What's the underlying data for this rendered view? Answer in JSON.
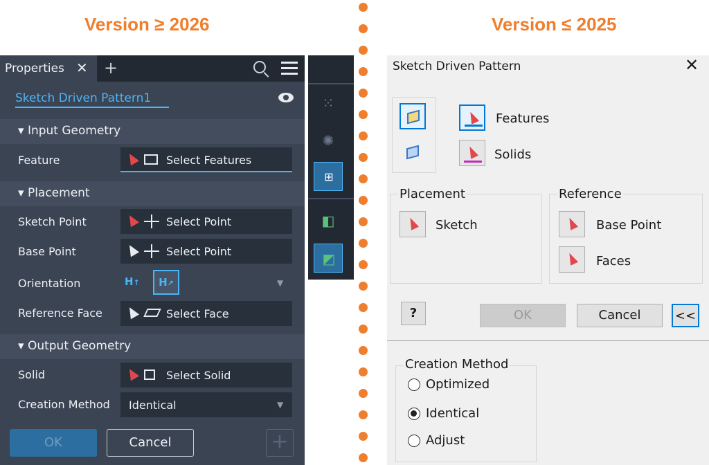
{
  "headers": {
    "left": "Version ≥ 2026",
    "right": "Version ≤ 2025"
  },
  "new_panel": {
    "tab_label": "Properties",
    "close_glyph": "✕",
    "add_glyph": "+",
    "feature_name": "Sketch Driven Pattern1",
    "sections": {
      "input": "Input Geometry",
      "placement": "Placement",
      "output": "Output Geometry"
    },
    "rows": {
      "feature_label": "Feature",
      "feature_value": "Select Features",
      "sketch_point_label": "Sketch Point",
      "sketch_point_value": "Select Point",
      "base_point_label": "Base Point",
      "base_point_value": "Select Point",
      "orientation_label": "Orientation",
      "reference_face_label": "Reference Face",
      "reference_face_value": "Select Face",
      "solid_label": "Solid",
      "solid_value": "Select Solid",
      "creation_method_label": "Creation Method",
      "creation_method_value": "Identical"
    },
    "buttons": {
      "ok": "OK",
      "cancel": "Cancel",
      "plus": "+"
    },
    "icons": [
      "search-icon",
      "menu-icon",
      "eye-icon",
      "select-cursor-icon",
      "point-cross-icon",
      "solid-icon",
      "face-icon"
    ]
  },
  "toolbar": {
    "tools": [
      "rectangular-pattern-icon",
      "circular-pattern-icon",
      "sketch-driven-pattern-icon",
      "mirror-icon",
      "pattern-solid-icon"
    ],
    "active": "sketch-driven-pattern-icon"
  },
  "old_dialog": {
    "title": "Sketch Driven Pattern",
    "close_glyph": "✕",
    "features_label": "Features",
    "solids_label": "Solids",
    "placement": {
      "title": "Placement",
      "sketch_label": "Sketch"
    },
    "reference": {
      "title": "Reference",
      "base_point_label": "Base Point",
      "faces_label": "Faces"
    },
    "help_glyph": "?",
    "ok": "OK",
    "cancel": "Cancel",
    "more": "<<",
    "creation_method": {
      "title": "Creation Method",
      "options": [
        "Optimized",
        "Identical",
        "Adjust"
      ],
      "selected": "Identical"
    }
  },
  "colors": {
    "accent_orange": "#ef7e2d",
    "dark_bg": "#3b4453",
    "dark_field": "#27303b",
    "blue_accent": "#4cb5f5",
    "ok_blue": "#2d6ea1",
    "light_bg": "#f0f0f0",
    "cursor_red": "#e0484d"
  }
}
